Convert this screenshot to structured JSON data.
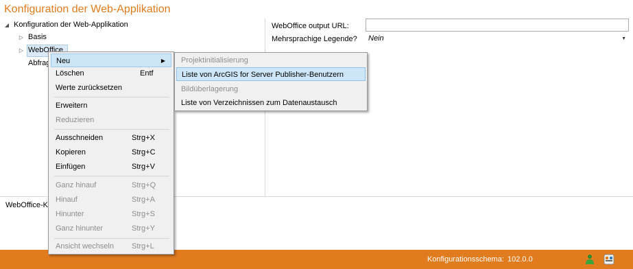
{
  "window": {
    "title": "Konfiguration der Web-Applikation"
  },
  "tree": {
    "root": "Konfiguration der Web-Applikation",
    "items": [
      "Basis",
      "WebOffice",
      "Abfrag"
    ]
  },
  "properties": {
    "output_url_label": "WebOffice output URL:",
    "output_url_value": "",
    "legend_label": "Mehrsprachige Legende?",
    "legend_value": "Nein"
  },
  "description": {
    "text": "WebOffice-Ko"
  },
  "context_menu": {
    "neu": "Neu",
    "loeschen": "Löschen",
    "loeschen_sc": "Entf",
    "zuruecksetzen": "Werte zurücksetzen",
    "erweitern": "Erweitern",
    "reduzieren": "Reduzieren",
    "ausschneiden": "Ausschneiden",
    "ausschneiden_sc": "Strg+X",
    "kopieren": "Kopieren",
    "kopieren_sc": "Strg+C",
    "einfuegen": "Einfügen",
    "einfuegen_sc": "Strg+V",
    "ganz_hinauf": "Ganz hinauf",
    "ganz_hinauf_sc": "Strg+Q",
    "hinauf": "Hinauf",
    "hinauf_sc": "Strg+A",
    "hinunter": "Hinunter",
    "hinunter_sc": "Strg+S",
    "ganz_hinunter": "Ganz hinunter",
    "ganz_hinunter_sc": "Strg+Y",
    "ansicht": "Ansicht wechseln",
    "ansicht_sc": "Strg+L"
  },
  "submenu": {
    "items": [
      "Projektinitialisierung",
      "Liste von ArcGIS for Server Publisher-Benutzern",
      "Bildüberlagerung",
      "Liste von Verzeichnissen zum Datenaustausch"
    ]
  },
  "status": {
    "label": "Konfigurationsschema:",
    "version": "102.0.0"
  },
  "colors": {
    "accent": "#e07b1e",
    "highlight": "#cde6f7",
    "disabled": "#8d8d8d"
  },
  "icons": [
    "expand-triangle-icon",
    "collapsed-triangle-icon",
    "submenu-arrow-icon",
    "dropdown-arrow-icon",
    "user-icon",
    "app-icon"
  ]
}
